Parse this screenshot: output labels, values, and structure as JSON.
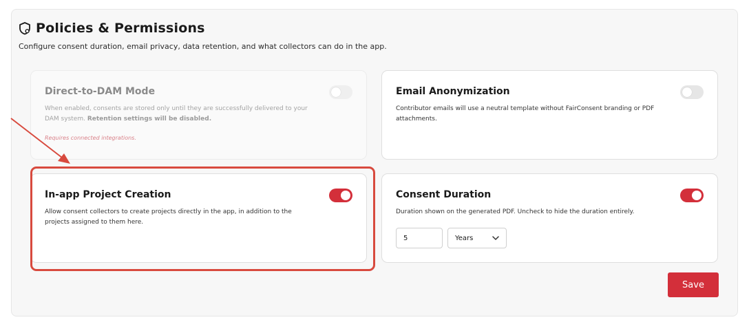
{
  "section": {
    "title": "Policies & Permissions",
    "subtitle": "Configure consent duration, email privacy, data retention, and what collectors can do in the app.",
    "icon": "shield-icon"
  },
  "cards": {
    "direct_to_dam": {
      "title": "Direct-to-DAM Mode",
      "desc_prefix": "When enabled, consents are stored only until they are successfully delivered to your DAM system. ",
      "desc_bold": "Retention settings will be disabled.",
      "note": "Requires connected integrations.",
      "enabled": false,
      "disabled": true
    },
    "email_anonymization": {
      "title": "Email Anonymization",
      "desc": "Contributor emails will use a neutral template without FairConsent branding or PDF attachments.",
      "enabled": false
    },
    "in_app_project_creation": {
      "title": "In-app Project Creation",
      "desc": "Allow consent collectors to create projects directly in the app, in addition to the projects assigned to them here.",
      "enabled": true,
      "highlighted": true
    },
    "consent_duration": {
      "title": "Consent Duration",
      "desc": "Duration shown on the generated PDF. Uncheck to hide the duration entirely.",
      "enabled": true,
      "value": "5",
      "unit": "Years",
      "unit_options": [
        "Years"
      ]
    }
  },
  "actions": {
    "save_label": "Save"
  },
  "colors": {
    "accent": "#d32f3a",
    "annotation": "#d84a3e"
  }
}
